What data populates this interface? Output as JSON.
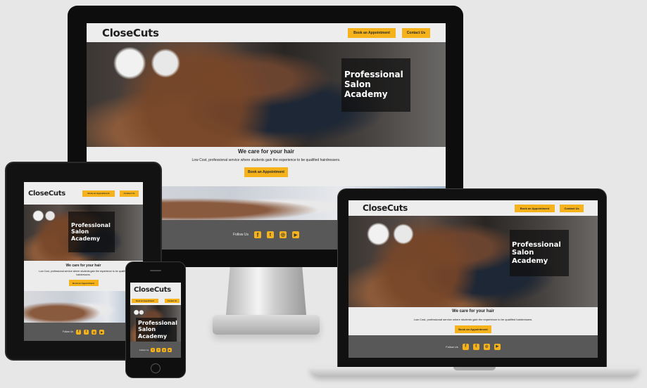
{
  "brand": "CloseCuts",
  "nav": {
    "book": "Book an Appointment",
    "contact": "Contact Us"
  },
  "hero": {
    "line1": "Professional",
    "line2": "Salon",
    "line3": "Academy"
  },
  "tagline": "We care for your hair",
  "intro": "Low Cost, professional service where students gain the experience to be qualified hairdressers.",
  "cta": "Book an Appointment",
  "footer": {
    "label": "Follow Us"
  },
  "icons": [
    "facebook-icon",
    "twitter-icon",
    "instagram-icon",
    "youtube-icon"
  ],
  "colors": {
    "accent": "#f5b21b",
    "footer": "#585858",
    "background": "#e7e7e7"
  }
}
